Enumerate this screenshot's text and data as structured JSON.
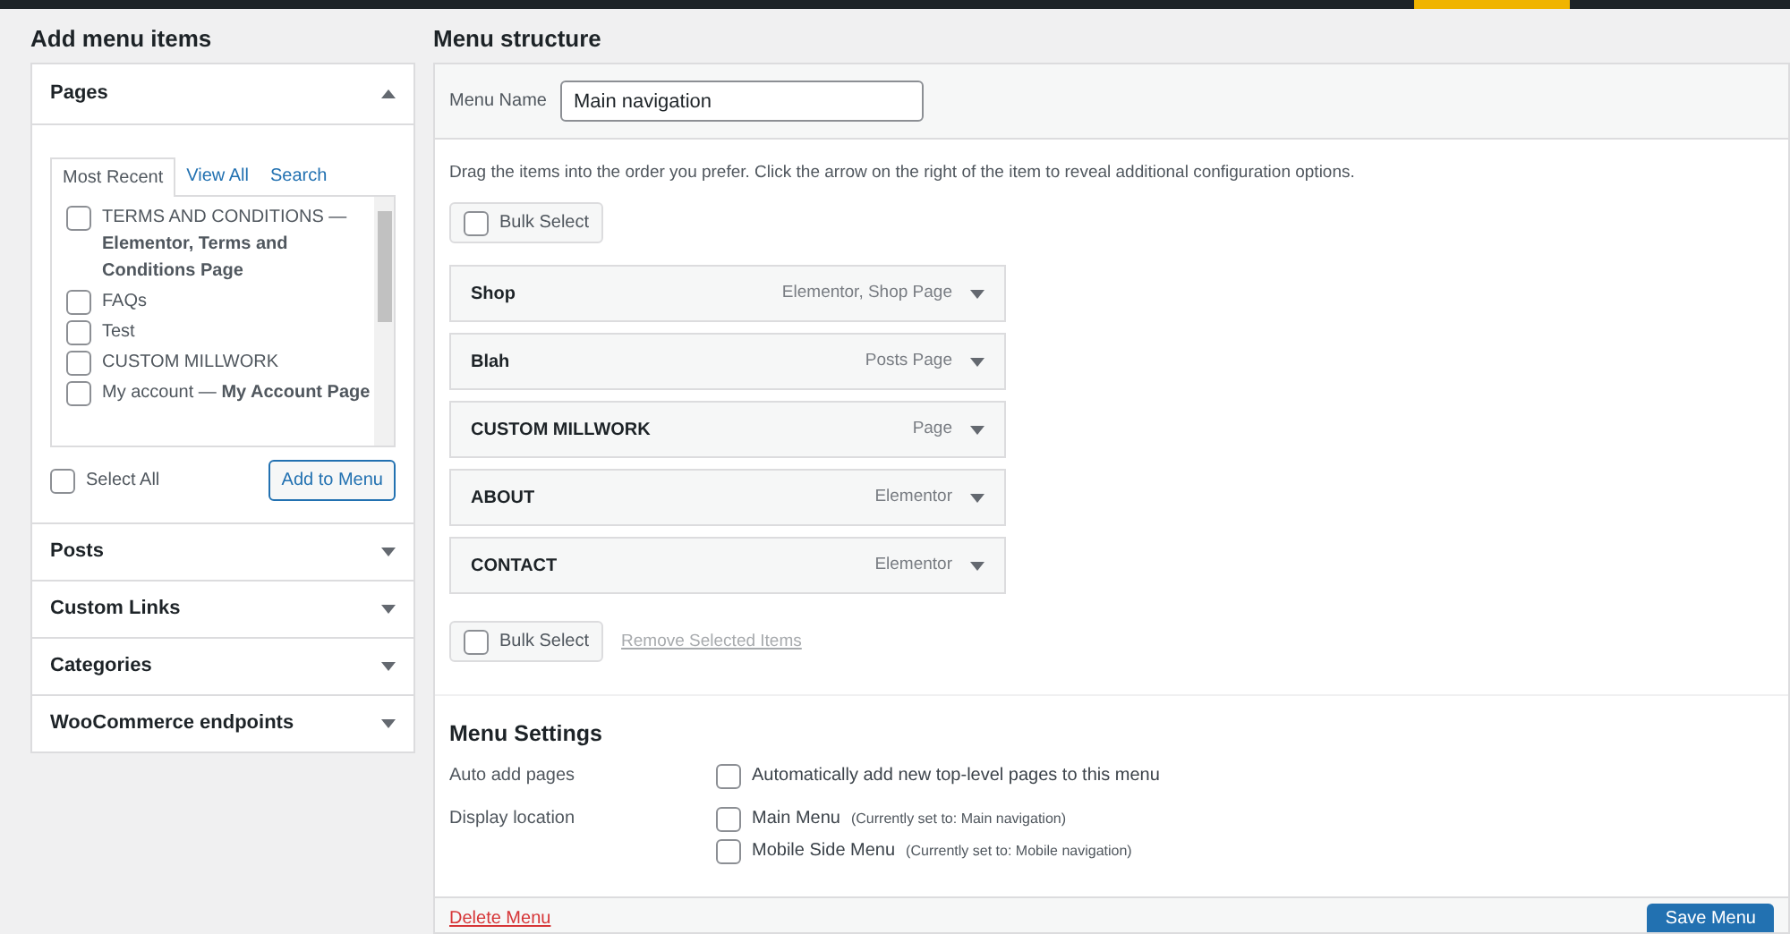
{
  "add_menu_items": {
    "title": "Add menu items",
    "panels": [
      {
        "title": "Pages",
        "expanded": true,
        "tabs": [
          {
            "label": "Most Recent",
            "selected": true
          },
          {
            "label": "View All",
            "selected": false
          },
          {
            "label": "Search",
            "selected": false
          }
        ],
        "items": [
          {
            "label": "TERMS AND CONDITIONS — **Elementor, Terms and Conditions Page**",
            "checked": false
          },
          {
            "label": "FAQs",
            "checked": false
          },
          {
            "label": "Test",
            "checked": false
          },
          {
            "label": "CUSTOM MILLWORK",
            "checked": false
          },
          {
            "label": "My account — **My Account Page**",
            "checked": false
          }
        ],
        "select_all": {
          "label": "Select All",
          "checked": false
        },
        "add_button": "Add to Menu"
      },
      {
        "title": "Posts",
        "expanded": false
      },
      {
        "title": "Custom Links",
        "expanded": false
      },
      {
        "title": "Categories",
        "expanded": false
      },
      {
        "title": "WooCommerce endpoints",
        "expanded": false
      }
    ]
  },
  "menu_structure": {
    "title": "Menu structure",
    "menu_name": {
      "label": "Menu Name",
      "value": "Main navigation"
    },
    "instructions": "Drag the items into the order you prefer. Click the arrow on the right of the item to reveal additional configuration options.",
    "bulk_select_top": {
      "label": "Bulk Select",
      "checked": false
    },
    "items": [
      {
        "title": "Shop",
        "type": "Elementor, Shop Page"
      },
      {
        "title": "Blah",
        "type": "Posts Page"
      },
      {
        "title": "CUSTOM MILLWORK",
        "type": "Page"
      },
      {
        "title": "ABOUT",
        "type": "Elementor"
      },
      {
        "title": "CONTACT",
        "type": "Elementor"
      }
    ],
    "bulk_select_bottom": {
      "label": "Bulk Select",
      "checked": false
    },
    "remove_link": "Remove Selected Items",
    "settings": {
      "title": "Menu Settings",
      "auto_add": {
        "label": "Auto add pages",
        "option": {
          "label": "Automatically add new top-level pages to this menu",
          "checked": false
        }
      },
      "display_location": {
        "label": "Display location",
        "options": [
          {
            "label": "Main Menu",
            "note": "(Currently set to: Main navigation)",
            "checked": false
          },
          {
            "label": "Mobile Side Menu",
            "note": "(Currently set to: Mobile navigation)",
            "checked": false
          }
        ]
      }
    },
    "footer": {
      "delete_link": "Delete Menu",
      "save_button": "Save Menu"
    }
  }
}
